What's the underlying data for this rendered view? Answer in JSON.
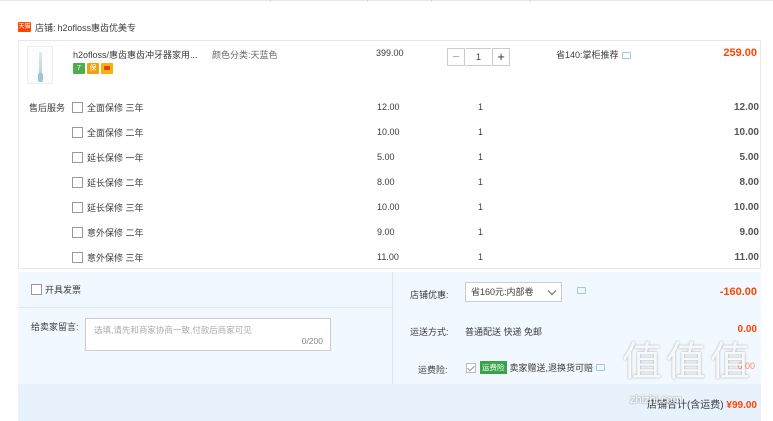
{
  "shop": {
    "badge": "天猫",
    "label": "店铺:",
    "name": "h2ofloss惠齿优美专"
  },
  "item": {
    "title": "h2ofloss/惠齿惠齿冲牙器家用...",
    "sku": "颜色分类:天蓝色",
    "icons": [
      "7",
      "保"
    ],
    "unit_price": "399.00",
    "quantity": "1",
    "minus": "−",
    "plus": "+",
    "save_text": "省140:掌柜推荐",
    "total": "259.00"
  },
  "services": {
    "label": "售后服务",
    "rows": [
      {
        "name": "全面保修 三年",
        "price": "12.00",
        "num": "1",
        "sum": "12.00"
      },
      {
        "name": "全面保修 二年",
        "price": "10.00",
        "num": "1",
        "sum": "10.00"
      },
      {
        "name": "延长保修 一年",
        "price": "5.00",
        "num": "1",
        "sum": "5.00"
      },
      {
        "name": "延长保修 二年",
        "price": "8.00",
        "num": "1",
        "sum": "8.00"
      },
      {
        "name": "延长保修 三年",
        "price": "10.00",
        "num": "1",
        "sum": "10.00"
      },
      {
        "name": "意外保修 二年",
        "price": "9.00",
        "num": "1",
        "sum": "9.00"
      },
      {
        "name": "意外保修 三年",
        "price": "11.00",
        "num": "1",
        "sum": "11.00"
      }
    ]
  },
  "footer": {
    "invoice_label": "开具发票",
    "message_label": "给卖家留言:",
    "message_placeholder": "选填,请先和商家协商一致,付款后商家可见",
    "message_count": "0/200",
    "promo_label": "店铺优惠:",
    "promo_selected": "省160元:内部卷",
    "promo_amount": "-160.00",
    "shipping_label": "运送方式:",
    "shipping_text": "普通配送 快递 免邮",
    "shipping_amount": "0.00",
    "insurance_label": "运费险:",
    "insurance_badge": "运费险",
    "insurance_text": "卖家赠送,退换货可赔",
    "insurance_amount": "0.00",
    "total_label": "店铺合计(含运费)",
    "total_amount": "¥99.00"
  },
  "watermark": {
    "chars": [
      "值",
      "值",
      "值"
    ],
    "url": "zhizhi.com"
  }
}
